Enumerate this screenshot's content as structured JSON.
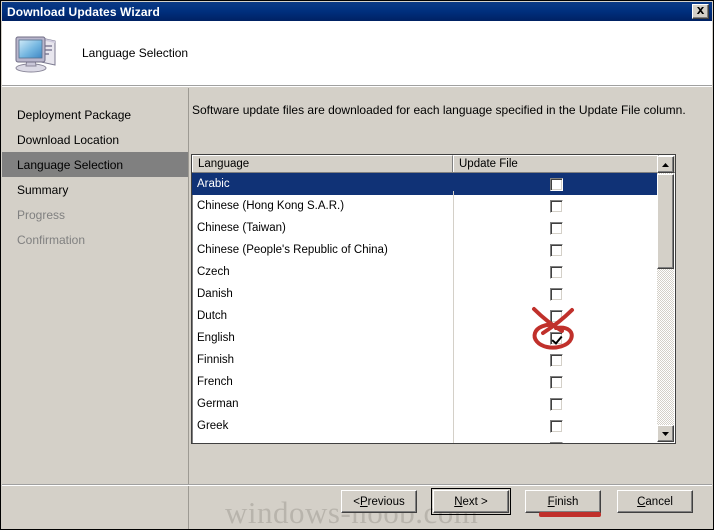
{
  "window": {
    "title": "Download Updates Wizard",
    "close_label": "Close",
    "close_icon": "close-icon"
  },
  "header": {
    "title": "Language Selection",
    "icon": "computer-icon"
  },
  "sidebar": {
    "items": [
      {
        "label": "Deployment Package",
        "state": "normal"
      },
      {
        "label": "Download Location",
        "state": "normal"
      },
      {
        "label": "Language Selection",
        "state": "selected"
      },
      {
        "label": "Summary",
        "state": "normal"
      },
      {
        "label": "Progress",
        "state": "disabled"
      },
      {
        "label": "Confirmation",
        "state": "disabled"
      }
    ]
  },
  "main": {
    "description": "Software update files are downloaded for each language specified in the Update File column.",
    "table": {
      "columns": [
        "Language",
        "Update File"
      ],
      "rows": [
        {
          "language": "Arabic",
          "checked": false,
          "selected": true
        },
        {
          "language": "Chinese (Hong Kong S.A.R.)",
          "checked": false,
          "selected": false
        },
        {
          "language": "Chinese (Taiwan)",
          "checked": false,
          "selected": false
        },
        {
          "language": "Chinese (People's Republic of China)",
          "checked": false,
          "selected": false
        },
        {
          "language": "Czech",
          "checked": false,
          "selected": false
        },
        {
          "language": "Danish",
          "checked": false,
          "selected": false
        },
        {
          "language": "Dutch",
          "checked": false,
          "selected": false
        },
        {
          "language": "English",
          "checked": true,
          "selected": false
        },
        {
          "language": "Finnish",
          "checked": false,
          "selected": false
        },
        {
          "language": "French",
          "checked": false,
          "selected": false
        },
        {
          "language": "German",
          "checked": false,
          "selected": false
        },
        {
          "language": "Greek",
          "checked": false,
          "selected": false
        }
      ]
    },
    "scrollbar": {
      "up_icon": "triangle-up-icon",
      "down_icon": "triangle-down-icon",
      "thumb_name": "scroll-thumb"
    }
  },
  "footer": {
    "buttons": [
      {
        "label": "< Previous",
        "accesskey": "P",
        "pre": "< ",
        "key": "P",
        "post": "revious",
        "default": false
      },
      {
        "label": "Next >",
        "accesskey": "N",
        "pre": "",
        "key": "N",
        "post": "ext >",
        "default": true
      },
      {
        "label": "Finish",
        "accesskey": "F",
        "pre": "",
        "key": "F",
        "post": "inish",
        "default": false
      },
      {
        "label": "Cancel",
        "accesskey": "C",
        "pre": "",
        "key": "C",
        "post": "ancel",
        "default": false
      }
    ]
  },
  "annotations": {
    "circle_target": "english-checkbox",
    "underline_target": "finish-button",
    "color": "#c0302b"
  },
  "watermark": {
    "text": "windows-noob.com"
  }
}
